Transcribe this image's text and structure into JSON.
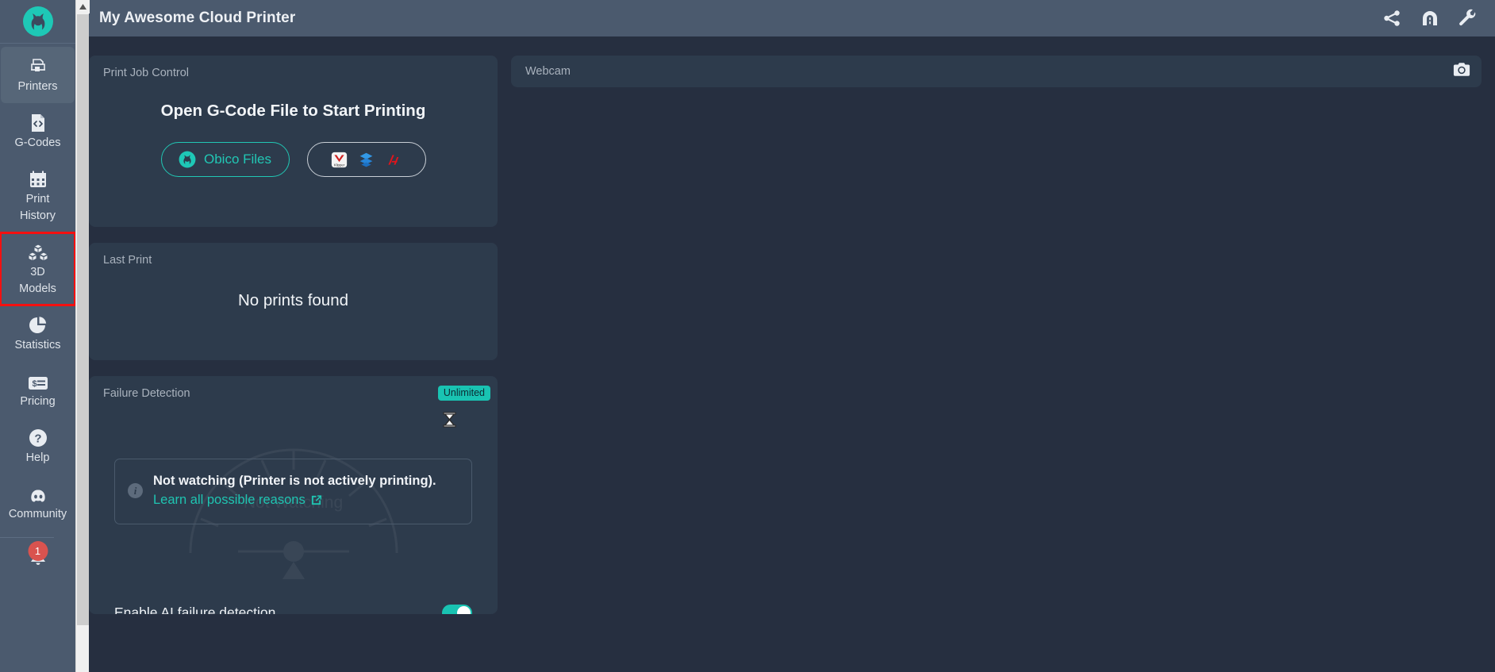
{
  "brand": {
    "name": "obico-logo"
  },
  "sidebar": {
    "items": [
      {
        "label": "Printers",
        "icon": "printer-icon",
        "state": "active"
      },
      {
        "label": "G-Codes",
        "icon": "gcode-file-icon",
        "state": "normal"
      },
      {
        "label": "Print\nHistory",
        "icon": "calendar-icon",
        "state": "normal"
      },
      {
        "label": "3D\nModels",
        "icon": "3d-models-icon",
        "state": "highlighted"
      },
      {
        "label": "Statistics",
        "icon": "pie-chart-icon",
        "state": "normal"
      },
      {
        "label": "Pricing",
        "icon": "price-tag-icon",
        "state": "normal"
      },
      {
        "label": "Help",
        "icon": "question-circle-icon",
        "state": "normal"
      },
      {
        "label": "Community",
        "icon": "discord-icon",
        "state": "normal"
      }
    ],
    "notifications": {
      "icon": "bell-icon",
      "count": "1"
    }
  },
  "header": {
    "title": "My Awesome Cloud Printer",
    "actions": [
      {
        "icon": "share-icon"
      },
      {
        "icon": "tunnel-icon"
      },
      {
        "icon": "wrench-icon"
      }
    ]
  },
  "print_job_control": {
    "title": "Print Job Control",
    "heading": "Open G-Code File to Start Printing",
    "obico_button": {
      "label": "Obico Files",
      "icon": "obico-logo-icon"
    },
    "slicer_button": {
      "icons": [
        "klipper-icon",
        "cura-icon",
        "prusaslicer-icon"
      ]
    }
  },
  "last_print": {
    "title": "Last Print",
    "message": "No prints found"
  },
  "failure_detection": {
    "title": "Failure Detection",
    "badge": "Unlimited",
    "gauge_label": "Not Watching",
    "alert_main": "Not watching (Printer is not actively printing).",
    "alert_link": "Learn all possible reasons",
    "toggle_label": "Enable AI failure detection",
    "toggle_state": "on"
  },
  "webcam": {
    "title": "Webcam",
    "camera_icon": "camera-icon"
  },
  "colors": {
    "accent": "#19c3b2",
    "sidebar": "#4b5a6e",
    "card": "#2d3b4c",
    "background": "#262f40",
    "highlight_border": "#f41010",
    "badge_red": "#d9534f"
  }
}
